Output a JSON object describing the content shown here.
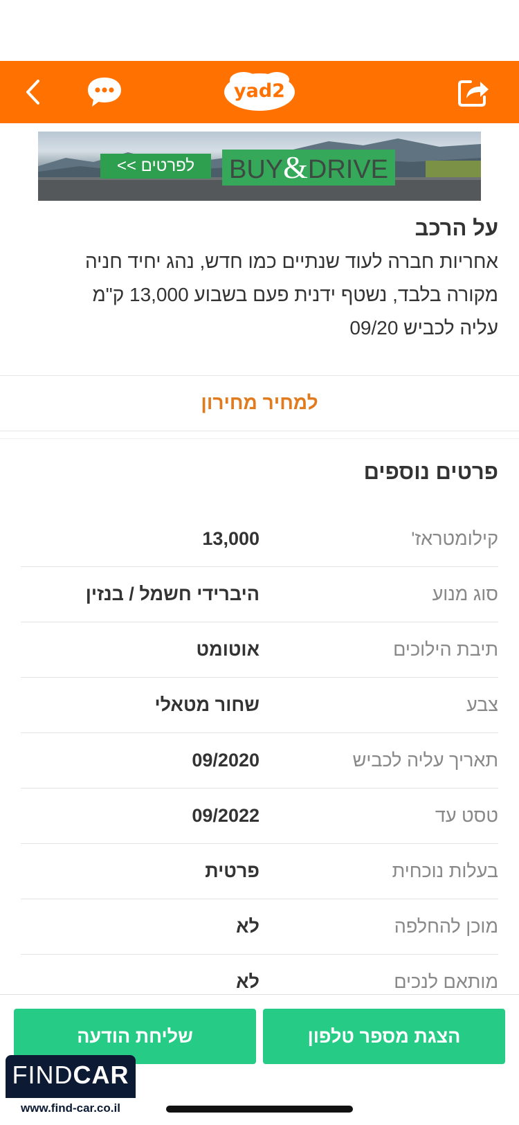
{
  "header": {
    "logo_text": "yad2",
    "brand_color": "#ff7100",
    "icons": [
      "chevron-left-icon",
      "chat-bubble-icon",
      "share-icon"
    ]
  },
  "banner": {
    "button_label": "לפרטים >>",
    "brand_left": "BUY",
    "brand_amp": "&",
    "brand_right": "DRIVE"
  },
  "about": {
    "title": "על הרכב",
    "description_lines": [
      "אחריות חברה לעוד שנתיים כמו חדש, נהג יחיד חניה",
      "מקורה בלבד, נשטף ידנית פעם בשבוע 13,000 ק\"מ",
      "עליה לכביש 09/20"
    ]
  },
  "price_link": "למחיר מחירון",
  "details": {
    "title": "פרטים נוספים",
    "rows": [
      {
        "label": "קילומטראז'",
        "value": "13,000"
      },
      {
        "label": "סוג מנוע",
        "value": "היברידי חשמל / בנזין"
      },
      {
        "label": "תיבת הילוכים",
        "value": "אוטומט"
      },
      {
        "label": "צבע",
        "value": "שחור מטאלי"
      },
      {
        "label": "תאריך עליה לכביש",
        "value": "09/2020"
      },
      {
        "label": "טסט עד",
        "value": "09/2022"
      },
      {
        "label": "בעלות נוכחית",
        "value": "פרטית"
      },
      {
        "label": "מוכן להחלפה",
        "value": "לא"
      },
      {
        "label": "מותאם לנכים",
        "value": "לא"
      }
    ]
  },
  "actions": {
    "send_message": "שליחת הודעה",
    "show_phone": "הצגת מספר טלפון",
    "button_color": "#26cc86"
  },
  "watermark": {
    "brand_light": "FIND",
    "brand_bold": "CAR",
    "url": "www.find-car.co.il"
  }
}
